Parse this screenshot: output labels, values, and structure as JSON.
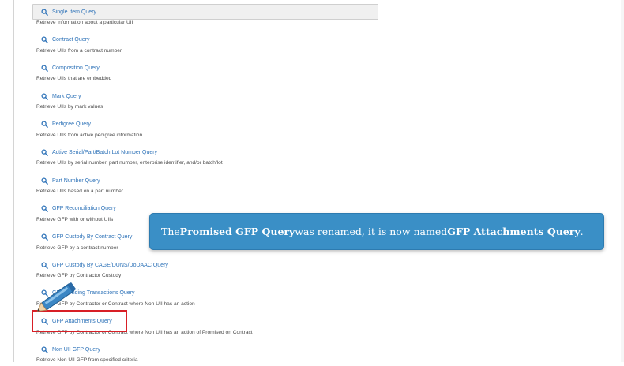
{
  "queries": [
    {
      "label": "Single Item Query",
      "desc": "Retrieve Information about a particular UII"
    },
    {
      "label": "Contract Query",
      "desc": "Retrieve UIIs from a contract number"
    },
    {
      "label": "Composition Query",
      "desc": "Retrieve UIIs that are embedded"
    },
    {
      "label": "Mark Query",
      "desc": "Retrieve UIIs by mark values"
    },
    {
      "label": "Pedigree Query",
      "desc": "Retrieve UIIs from active pedigree information"
    },
    {
      "label": "Active Serial/Part/Batch Lot Number Query",
      "desc": "Retrieve UIIs by serial number, part number, enterprise identifier, and/or batch/lot"
    },
    {
      "label": "Part Number Query",
      "desc": "Retrieve UIIs based on a part number"
    },
    {
      "label": "GFP Reconciliation Query",
      "desc": "Retrieve GFP with or without UIIs"
    },
    {
      "label": "GFP Custody By Contract Query",
      "desc": "Retrieve GFP by a contract number"
    },
    {
      "label": "GFP Custody By CAGE/DUNS/DoDAAC Query",
      "desc": "Retrieve GFP by Contractor Custody"
    },
    {
      "label": "GFP Pending Transactions Query",
      "desc": "Retrieve GFP by Contractor or Contract where Non UII has an action"
    },
    {
      "label": "GFP Attachments Query",
      "desc": "Retrieve GFP by Contractor or Contract where Non UII has an action of Promised on Contract"
    },
    {
      "label": "Non UII GFP Query",
      "desc": "Retrieve Non UII GFP from specified criteria"
    }
  ],
  "callout": {
    "prefix": "The ",
    "old_name": "Promised GFP Query",
    "middle": " was renamed, it is now named ",
    "new_name": "GFP Attachments Query",
    "suffix": "."
  },
  "icons": {
    "query": "search-icon",
    "annotation": "pen-icon"
  },
  "colors": {
    "link": "#2d72b8",
    "callout_bg": "#3a8fc6",
    "highlight": "#d81f26"
  }
}
